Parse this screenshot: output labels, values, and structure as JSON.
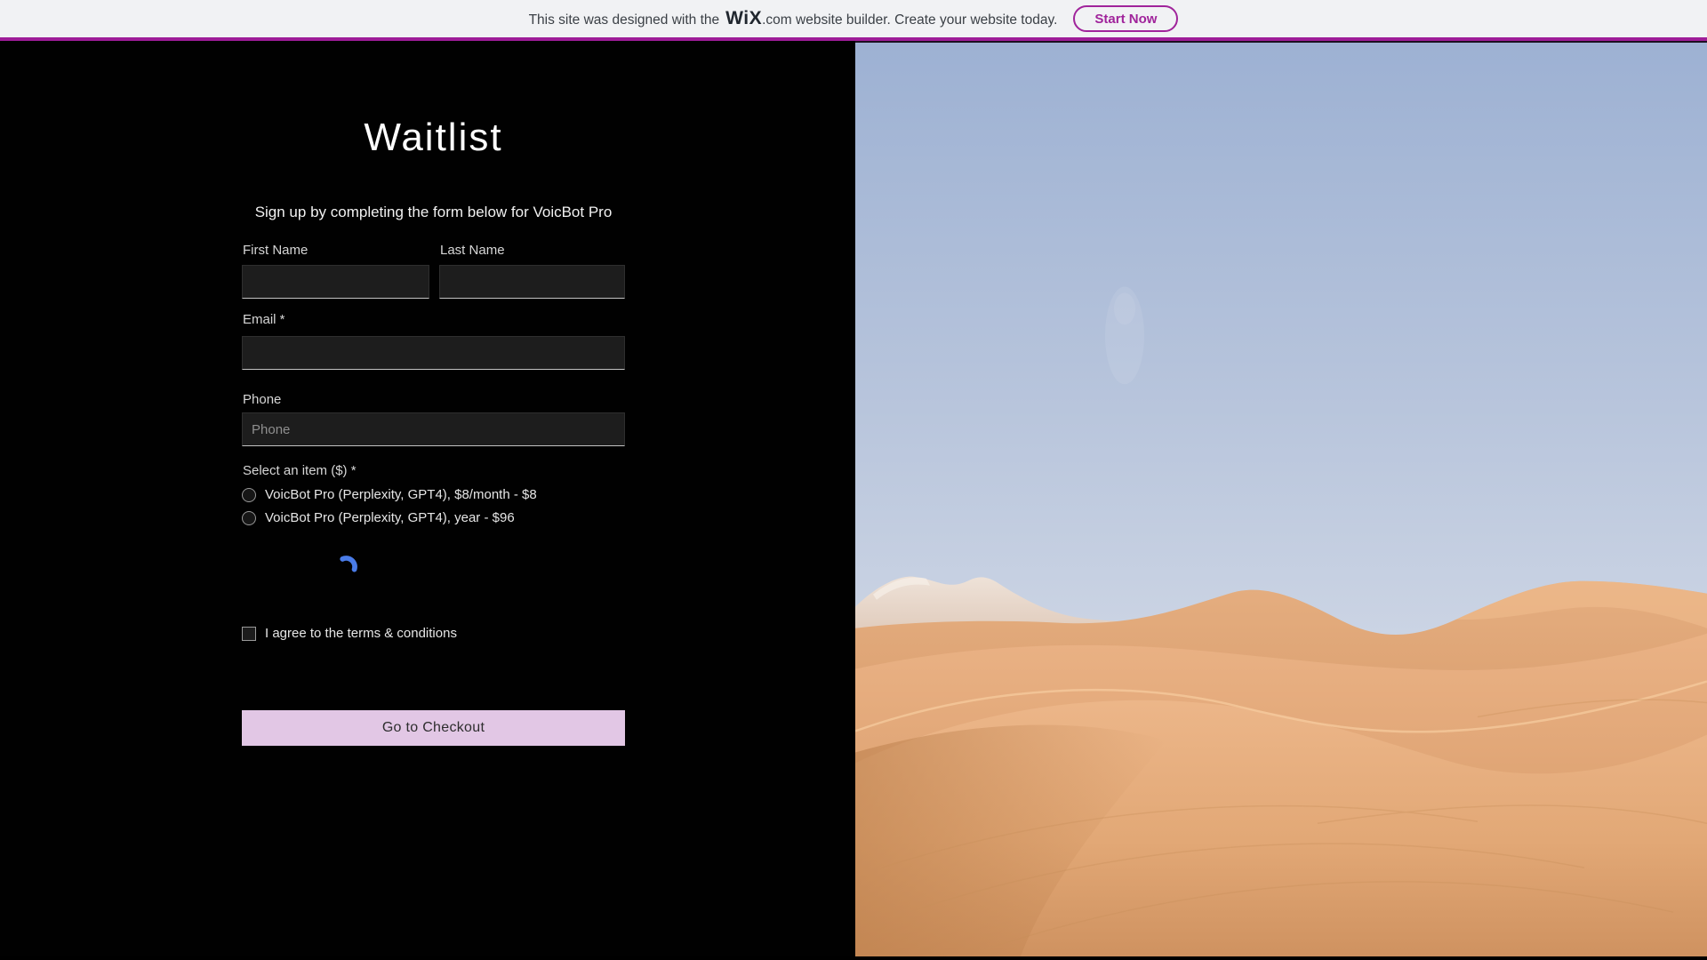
{
  "banner": {
    "text_before": "This site was designed with the",
    "logo_text": "WiX",
    "text_after": ".com website builder. Create your website today.",
    "start_button_label": "Start Now"
  },
  "colors": {
    "banner_accent": "#9e1d98",
    "start_button": "#a0249b",
    "checkout_button_bg": "#e2c7e5",
    "spinner_blue": "#4a7ce8",
    "panel_bg": "#000000"
  },
  "form": {
    "title": "Waitlist",
    "subtitle": "Sign up by completing the form below for VoicBot Pro",
    "first_name": {
      "label": "First Name",
      "value": ""
    },
    "last_name": {
      "label": "Last Name",
      "value": ""
    },
    "email": {
      "label": "Email *",
      "value": ""
    },
    "phone": {
      "label": "Phone",
      "value": "",
      "placeholder": "Phone"
    },
    "select_item": {
      "label": "Select an item ($) *",
      "options": [
        {
          "label": "VoicBot Pro (Perplexity, GPT4), $8/month - $8",
          "selected": false
        },
        {
          "label": "VoicBot Pro (Perplexity, GPT4), year - $96",
          "selected": false
        }
      ]
    },
    "terms": {
      "label": "I agree to the terms & conditions",
      "checked": false
    },
    "submit_label": "Go to Checkout",
    "status": {
      "loading": true
    }
  },
  "image": {
    "alt": "Desert sand dunes under a pale blue sky"
  }
}
